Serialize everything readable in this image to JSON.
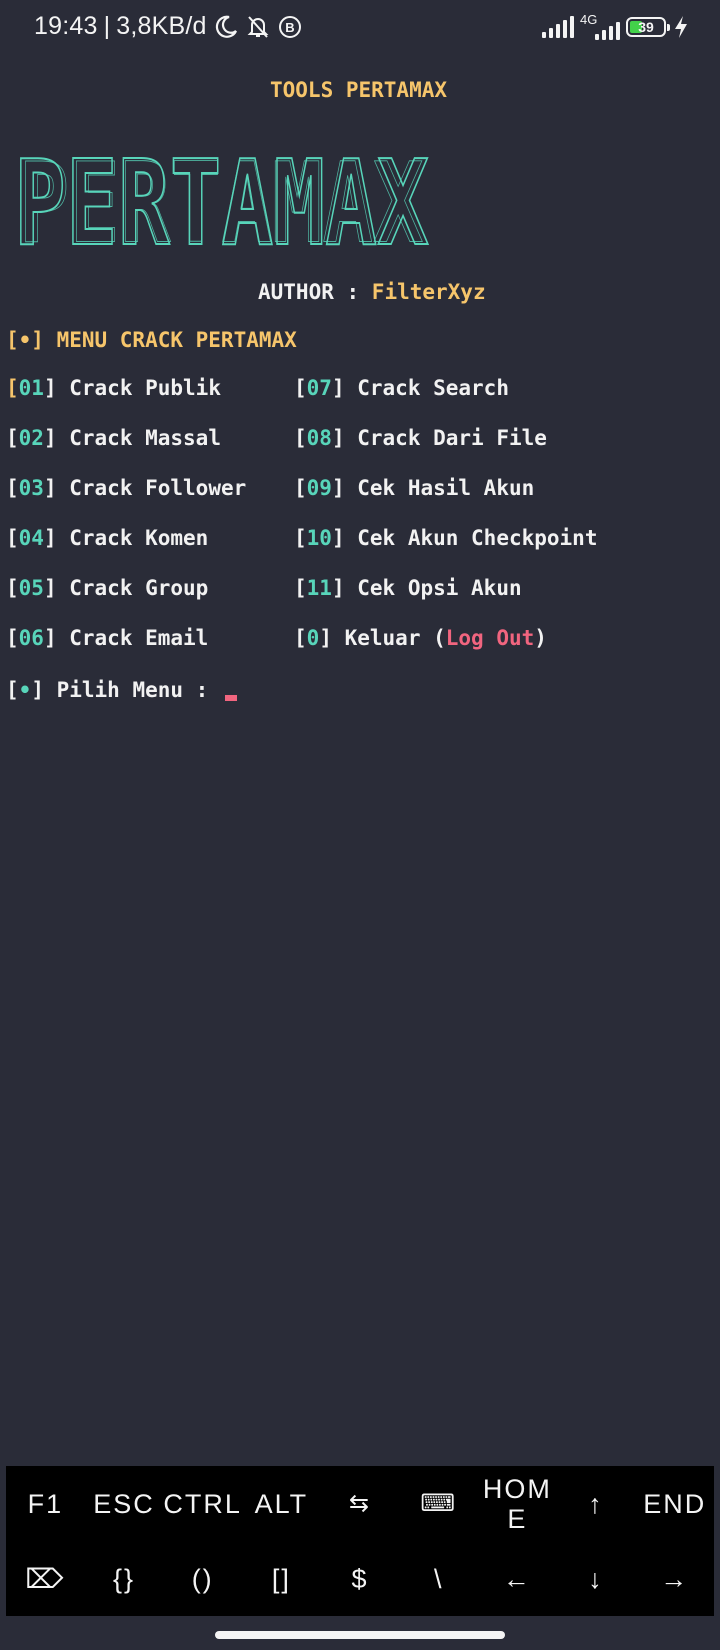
{
  "status_bar": {
    "time": "19:43",
    "separator": "|",
    "net_speed": "3,8KB/d",
    "network_type": "4G",
    "battery_level": "39",
    "icons": [
      "moon-icon",
      "bell-off-icon",
      "b-circle-icon",
      "signal-icon",
      "charging-icon"
    ]
  },
  "terminal": {
    "title": "TOOLS PERTAMAX",
    "banner_word": "PERTAMAX",
    "author_label": "AUTHOR : ",
    "author_name": "FilterXyz",
    "menu_header": "[•] MENU CRACK PERTAMAX",
    "menu_items": [
      {
        "num": "01",
        "label": "Crack Publik"
      },
      {
        "num": "02",
        "label": "Crack Massal"
      },
      {
        "num": "03",
        "label": "Crack Follower"
      },
      {
        "num": "04",
        "label": "Crack Komen"
      },
      {
        "num": "05",
        "label": "Crack Group"
      },
      {
        "num": "06",
        "label": "Crack Email"
      },
      {
        "num": "07",
        "label": "Crack Search"
      },
      {
        "num": "08",
        "label": "Crack Dari File"
      },
      {
        "num": "09",
        "label": "Cek Hasil Akun"
      },
      {
        "num": "10",
        "label": "Cek Akun Checkpoint"
      },
      {
        "num": "11",
        "label": "Cek Opsi Akun"
      }
    ],
    "exit_item": {
      "num": "0",
      "label": "Keluar (",
      "highlight": "Log Out",
      "suffix": ")"
    },
    "prompt_bullet": "•",
    "prompt_label": "Pilih Menu : "
  },
  "extra_keys": {
    "row1": [
      "F1",
      "ESC",
      "CTRL",
      "ALT",
      "⇆",
      "⌨",
      "HOME",
      "↑",
      "END"
    ],
    "row2": [
      "⌦",
      "{}",
      "()",
      "[]",
      "$",
      "\\",
      "←",
      "↓",
      "→"
    ]
  },
  "colors": {
    "background": "#2a2c38",
    "yellow": "#f6c56b",
    "cyan": "#58d5ba",
    "pink": "#f1657f"
  }
}
